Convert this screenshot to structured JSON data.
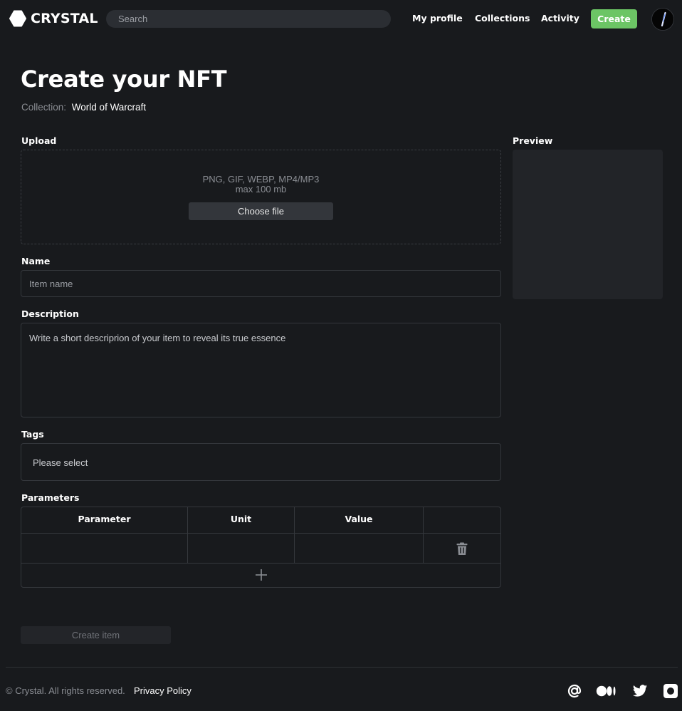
{
  "header": {
    "brand": "CRYSTAL",
    "search_placeholder": "Search",
    "nav": [
      "My profile",
      "Collections",
      "Activity"
    ],
    "create_label": "Create",
    "accent_color": "#6cc565",
    "icons": {
      "logo": "hexagon-logo-icon",
      "avatar": "avatar-image"
    }
  },
  "page": {
    "title": "Create your NFT",
    "collection_label": "Collection:",
    "collection_value": "World of Warcraft"
  },
  "upload": {
    "label": "Upload",
    "formats": "PNG, GIF, WEBP, MP4/MP3",
    "max_size": "max 100 mb",
    "choose_label": "Choose file"
  },
  "preview": {
    "label": "Preview"
  },
  "name": {
    "label": "Name",
    "placeholder": "Item name"
  },
  "description": {
    "label": "Description",
    "placeholder": "Write a short descriprion of your item to reveal its true essence"
  },
  "tags": {
    "label": "Tags",
    "placeholder": "Please select"
  },
  "parameters": {
    "label": "Parameters",
    "columns": [
      "Parameter",
      "Unit",
      "Value"
    ],
    "icons": {
      "delete": "trash-icon",
      "add": "plus-icon"
    }
  },
  "submit": {
    "label": "Create item"
  },
  "footer": {
    "copyright": "© Crystal. All rights reserved.",
    "privacy": "Privacy Policy",
    "social_icons": [
      "at-sign-icon",
      "medium-icon",
      "twitter-icon",
      "camera-icon"
    ]
  }
}
